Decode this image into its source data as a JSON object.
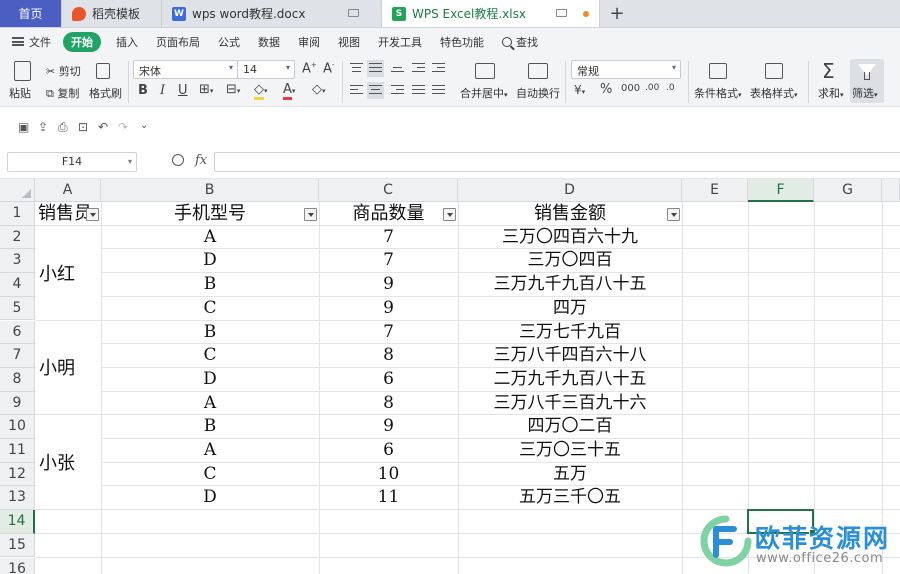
{
  "tabs": [
    {
      "label": "首页"
    },
    {
      "label": "稻壳模板",
      "icon": "daoke-icon"
    },
    {
      "label": "wps word教程.docx",
      "icon": "word-doc-icon"
    },
    {
      "label": "WPS Excel教程.xlsx",
      "icon": "excel-doc-icon"
    }
  ],
  "menu": {
    "file": "文件",
    "items": [
      "开始",
      "插入",
      "页面布局",
      "公式",
      "数据",
      "审阅",
      "视图",
      "开发工具",
      "特色功能"
    ],
    "search": "查找"
  },
  "ribbon": {
    "paste": "粘贴",
    "cut": "剪切",
    "copy": "复制",
    "format_painter": "格式刷",
    "font_name": "宋体",
    "font_size": "14",
    "merge_center": "合并居中",
    "wrap_text": "自动换行",
    "number_format": "常规",
    "conditional_format": "条件格式",
    "table_style": "表格样式",
    "sum": "求和",
    "filter": "筛选"
  },
  "formula_bar": {
    "name_box": "F14",
    "fx": "fx",
    "content": ""
  },
  "columns": [
    "A",
    "B",
    "C",
    "D",
    "E",
    "F",
    "G"
  ],
  "rows": [
    "1",
    "2",
    "3",
    "4",
    "5",
    "6",
    "7",
    "8",
    "9",
    "10",
    "11",
    "12",
    "13",
    "14",
    "15",
    "16"
  ],
  "active_cell": {
    "column": "F",
    "row": "14"
  },
  "table": {
    "headers": [
      "销售员",
      "手机型号",
      "商品数量",
      "销售金额"
    ],
    "salespeople": [
      "小红",
      "小明",
      "小张"
    ],
    "data": [
      [
        "A",
        "7",
        "三万〇四百六十九"
      ],
      [
        "D",
        "7",
        "三万〇四百"
      ],
      [
        "B",
        "9",
        "三万九千九百八十五"
      ],
      [
        "C",
        "9",
        "四万"
      ],
      [
        "B",
        "7",
        "三万七千九百"
      ],
      [
        "C",
        "8",
        "三万八千四百六十八"
      ],
      [
        "D",
        "6",
        "二万九千九百八十五"
      ],
      [
        "A",
        "8",
        "三万八千三百九十六"
      ],
      [
        "B",
        "9",
        "四万〇二百"
      ],
      [
        "A",
        "6",
        "三万〇三十五"
      ],
      [
        "C",
        "10",
        "五万"
      ],
      [
        "D",
        "11",
        "五万三千〇五"
      ]
    ]
  },
  "watermark": {
    "title": "欧菲资源网",
    "url": "www.office26.com"
  },
  "colors": {
    "accent": "#21a366",
    "selection": "#217346",
    "home_tab": "#4a5fc1"
  }
}
